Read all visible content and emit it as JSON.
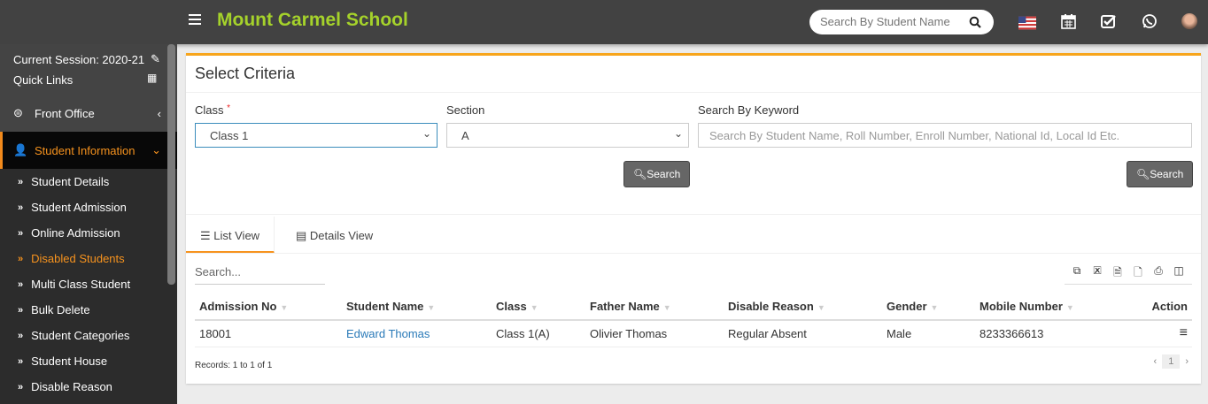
{
  "header": {
    "title": "Mount Carmel School",
    "search_placeholder": "Search By Student Name",
    "icons": [
      "menu-icon",
      "search-icon",
      "us-flag-icon",
      "calendar-icon",
      "checkbox-icon",
      "whatsapp-icon",
      "user-avatar"
    ],
    "brand_color": "#a5d22b"
  },
  "sidebar": {
    "session": "Current Session: 2020-21",
    "quick_links": "Quick Links",
    "front_office": "Front Office",
    "student_information": "Student Information",
    "items": [
      {
        "label": "Student Details"
      },
      {
        "label": "Student Admission"
      },
      {
        "label": "Online Admission"
      },
      {
        "label": "Disabled Students",
        "active": true
      },
      {
        "label": "Multi Class Student"
      },
      {
        "label": "Bulk Delete"
      },
      {
        "label": "Student Categories"
      },
      {
        "label": "Student House"
      },
      {
        "label": "Disable Reason"
      }
    ],
    "accent_color": "#f7931e"
  },
  "criteria": {
    "title": "Select Criteria",
    "class_label": "Class",
    "required_mark": "*",
    "class_value": "Class 1",
    "section_label": "Section",
    "section_value": "A",
    "keyword_label": "Search By Keyword",
    "keyword_placeholder": "Search By Student Name, Roll Number, Enroll Number, National Id, Local Id Etc.",
    "search_button": "Search"
  },
  "tabs": [
    {
      "label": "List View",
      "active": true
    },
    {
      "label": "Details View"
    }
  ],
  "table": {
    "search_placeholder": "Search...",
    "export_icons": [
      "copy-icon",
      "excel-icon",
      "csv-icon",
      "pdf-icon",
      "print-icon",
      "columns-icon"
    ],
    "columns": [
      "Admission No",
      "Student Name",
      "Class",
      "Father Name",
      "Disable Reason",
      "Gender",
      "Mobile Number",
      "Action"
    ],
    "rows": [
      {
        "admission_no": "18001",
        "student_name": "Edward Thomas",
        "class": "Class 1(A)",
        "father_name": "Olivier Thomas",
        "disable_reason": "Regular Absent",
        "gender": "Male",
        "mobile": "8233366613"
      }
    ],
    "records": "Records: 1 to 1 of 1",
    "page": "1",
    "prev": "‹",
    "next": "›"
  }
}
